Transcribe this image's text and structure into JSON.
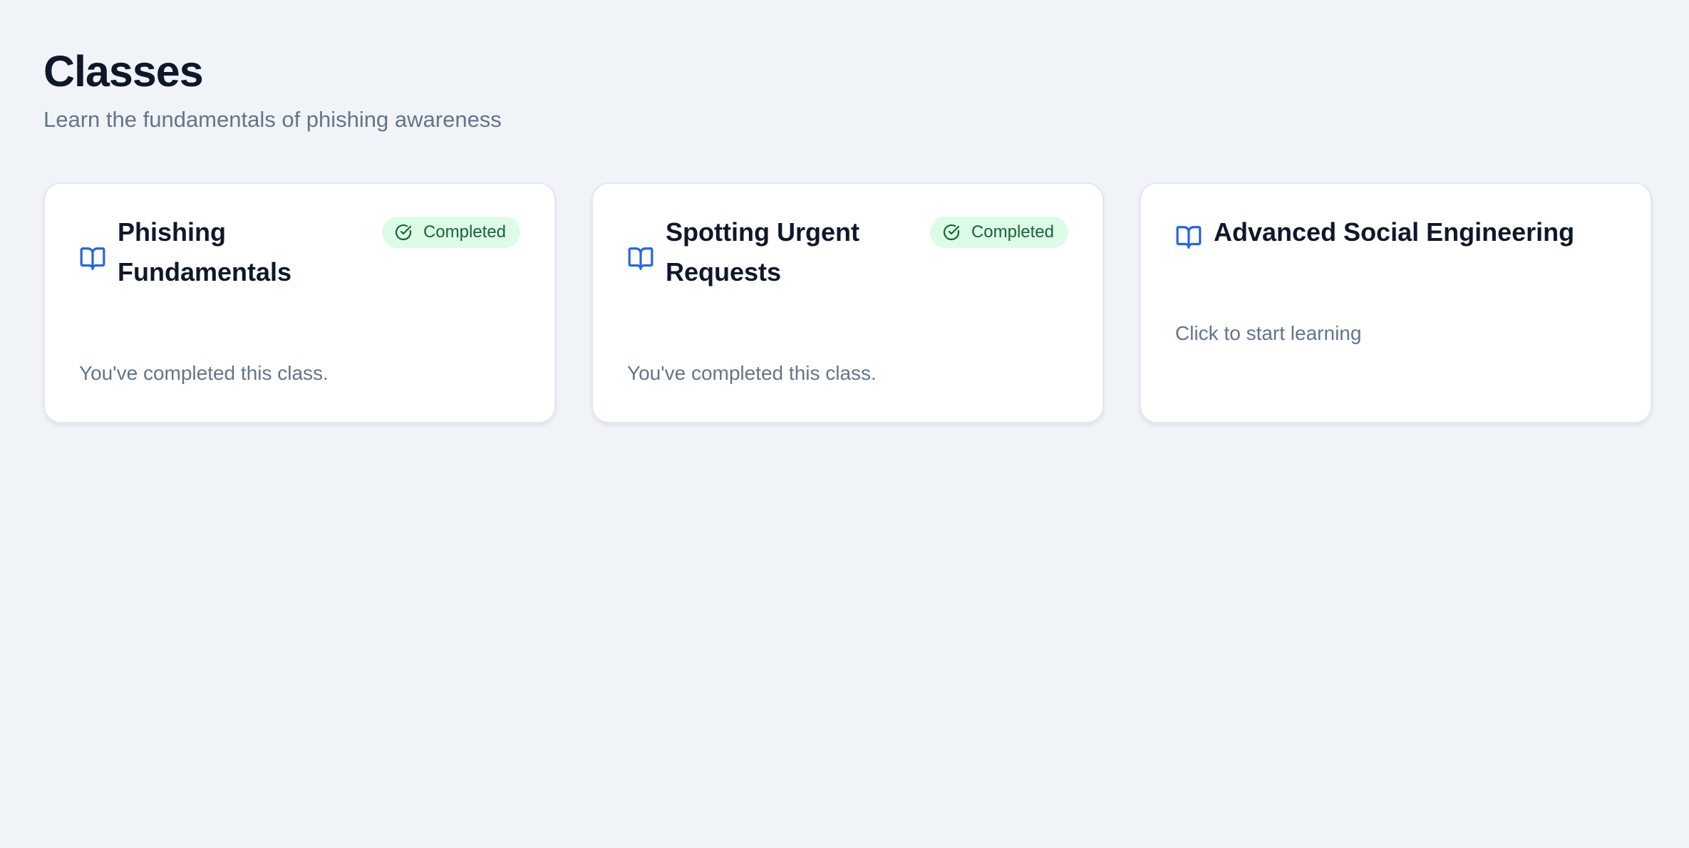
{
  "header": {
    "title": "Classes",
    "subtitle": "Learn the fundamentals of phishing awareness"
  },
  "classes": [
    {
      "icon": "book-open-icon",
      "title": "Phishing Fundamentals",
      "status": "Completed",
      "description": "You've completed this class."
    },
    {
      "icon": "book-open-icon",
      "title": "Spotting Urgent Requests",
      "status": "Completed",
      "description": "You've completed this class."
    },
    {
      "icon": "book-open-icon",
      "title": "Advanced Social Engineering",
      "description": "Click to start learning"
    }
  ],
  "colors": {
    "background": "#f0f4f9",
    "card_background": "#ffffff",
    "accent_blue": "#2563eb",
    "completed_badge_bg": "#dcfce7",
    "completed_badge_text": "#166534",
    "heading": "#0f172a",
    "muted_text": "#64748b"
  }
}
